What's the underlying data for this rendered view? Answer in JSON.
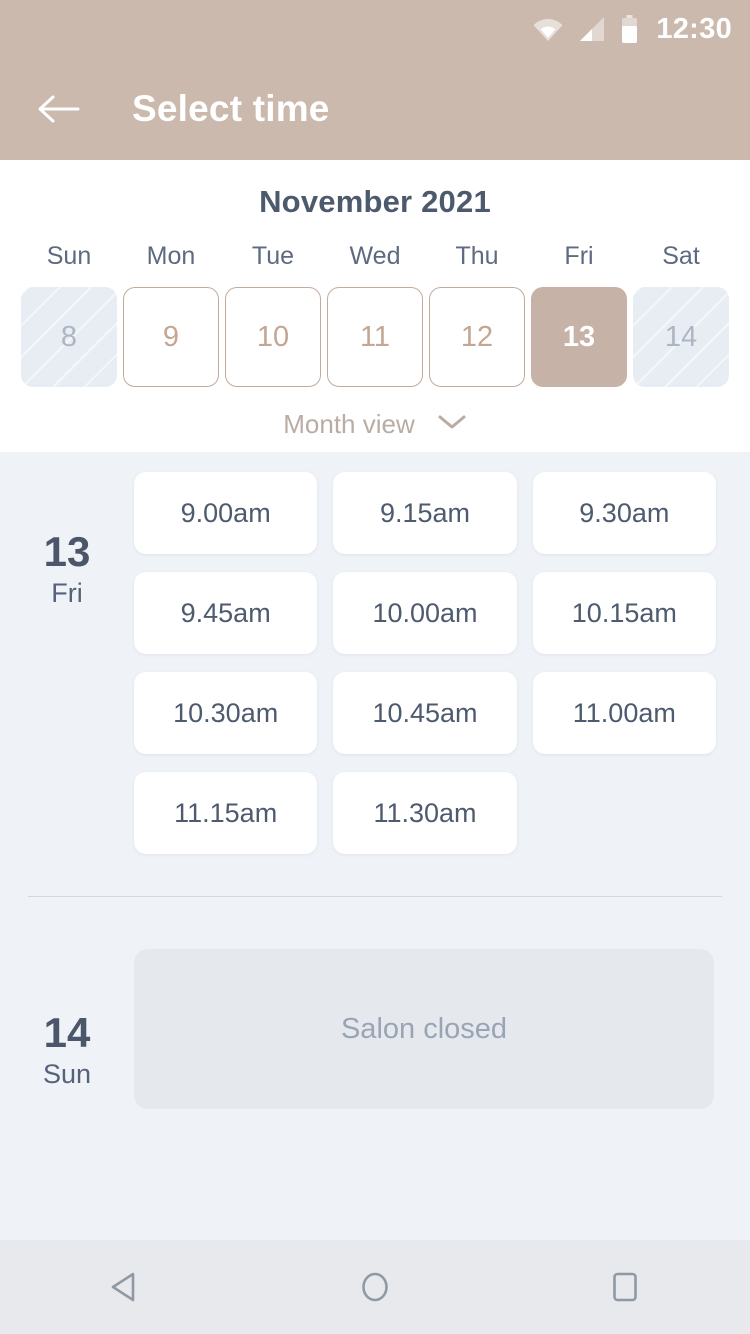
{
  "status_bar": {
    "time": "12:30",
    "icons": [
      "wifi-icon",
      "signal-icon",
      "battery-icon"
    ]
  },
  "app_bar": {
    "back_icon": "back-arrow-icon",
    "title": "Select time"
  },
  "calendar": {
    "month_label": "November 2021",
    "weekdays": [
      "Sun",
      "Mon",
      "Tue",
      "Wed",
      "Thu",
      "Fri",
      "Sat"
    ],
    "dates": [
      {
        "day": "8",
        "state": "disabled"
      },
      {
        "day": "9",
        "state": "available"
      },
      {
        "day": "10",
        "state": "available"
      },
      {
        "day": "11",
        "state": "available"
      },
      {
        "day": "12",
        "state": "available"
      },
      {
        "day": "13",
        "state": "selected"
      },
      {
        "day": "14",
        "state": "disabled"
      }
    ],
    "view_toggle_label": "Month view",
    "view_toggle_icon": "chevron-down-icon"
  },
  "schedule": [
    {
      "day_number": "13",
      "day_of_week": "Fri",
      "closed": false,
      "slots": [
        "9.00am",
        "9.15am",
        "9.30am",
        "9.45am",
        "10.00am",
        "10.15am",
        "10.30am",
        "10.45am",
        "11.00am",
        "11.15am",
        "11.30am"
      ]
    },
    {
      "day_number": "14",
      "day_of_week": "Sun",
      "closed": true,
      "closed_label": "Salon closed",
      "slots": []
    }
  ],
  "nav_bar": {
    "back_label": "back-nav-icon",
    "home_label": "home-nav-icon",
    "recents_label": "recents-nav-icon"
  },
  "colors": {
    "accent": "#cbb9ae",
    "selected_date": "#c6b2a6",
    "date_border": "#c3ab9b",
    "background": "#eff3f8",
    "text_dark": "#4d5a6e",
    "text_muted": "#9aa4b4",
    "card": "#ffffff",
    "closed_card": "#e5e9ee",
    "nav_bar": "#e7e9ec"
  }
}
